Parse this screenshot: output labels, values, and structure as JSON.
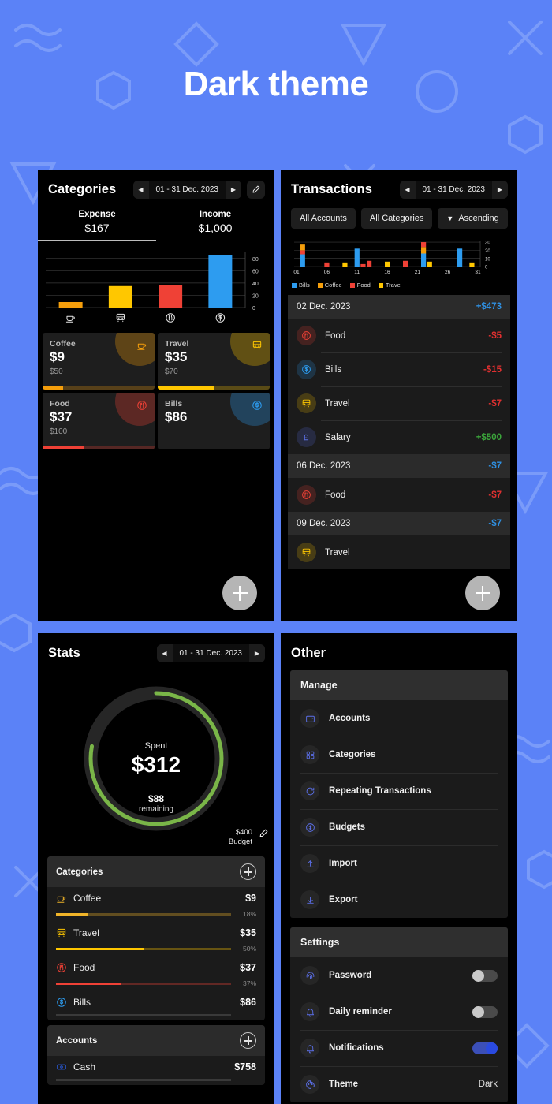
{
  "hero": {
    "title": "Dark theme"
  },
  "colors": {
    "background": "#5b82f7",
    "panel": "#000000",
    "coffee": "#f59e0b",
    "travel": "#ffc700",
    "food": "#ef4136",
    "bills": "#2d9cf0",
    "income_green": "#3ba53b",
    "expense_red": "#e03030",
    "accent_blue": "#2f8fe0",
    "donut_green": "#7ab648"
  },
  "categories_panel": {
    "title": "Categories",
    "date_range": "01 - 31 Dec. 2023",
    "prev_icon": "chevron-left-icon",
    "next_icon": "chevron-right-icon",
    "edit_icon": "pencil-icon",
    "summary": [
      {
        "label": "Expense",
        "value": "$167",
        "selected": true
      },
      {
        "label": "Income",
        "value": "$1,000",
        "selected": false
      }
    ],
    "chart_data": {
      "type": "bar",
      "title": "Expense by category",
      "categories": [
        "Coffee",
        "Travel",
        "Food",
        "Bills"
      ],
      "values": [
        9,
        35,
        37,
        86
      ],
      "colors": [
        "#f59e0b",
        "#ffc700",
        "#ef4136",
        "#2d9cf0"
      ],
      "icons": [
        "coffee-icon",
        "bus-icon",
        "food-icon",
        "dollar-coin-icon"
      ],
      "ylim": [
        0,
        90
      ],
      "yticks": [
        0,
        20,
        40,
        60,
        80
      ],
      "xlabel": "",
      "ylabel": "",
      "grid": true,
      "legend": "none"
    },
    "cards": [
      {
        "name": "Coffee",
        "amount": "$9",
        "budget": "$50",
        "progress": 18,
        "color": "#f59e0b",
        "icon": "coffee-icon"
      },
      {
        "name": "Travel",
        "amount": "$35",
        "budget": "$70",
        "progress": 50,
        "color": "#ffc700",
        "icon": "bus-icon"
      },
      {
        "name": "Food",
        "amount": "$37",
        "budget": "$100",
        "progress": 37,
        "color": "#ef4136",
        "icon": "food-icon"
      },
      {
        "name": "Bills",
        "amount": "$86",
        "budget": "",
        "progress": 0,
        "color": "#2d9cf0",
        "icon": "dollar-coin-icon"
      }
    ],
    "fab_icon": "plus-icon"
  },
  "transactions_panel": {
    "title": "Transactions",
    "date_range": "01 - 31 Dec. 2023",
    "filters": [
      {
        "label": "All Accounts",
        "icon": ""
      },
      {
        "label": "All Categories",
        "icon": ""
      },
      {
        "label": "Ascending",
        "icon": "sort-triangle-icon"
      }
    ],
    "chart_data": {
      "type": "bar",
      "title": "Transactions by day",
      "x": [
        1,
        2,
        3,
        4,
        5,
        6,
        7,
        8,
        9,
        10,
        11,
        12,
        13,
        14,
        15,
        16,
        17,
        18,
        19,
        20,
        21,
        22,
        23,
        24,
        25,
        26,
        27,
        28,
        29,
        30,
        31
      ],
      "xticks": [
        "01",
        "06",
        "11",
        "16",
        "21",
        "26",
        "31"
      ],
      "yticks": [
        0,
        10,
        20,
        30
      ],
      "ylim": [
        0,
        32
      ],
      "legend": [
        "Bills",
        "Coffee",
        "Food",
        "Travel"
      ],
      "legend_colors": [
        "#2d9cf0",
        "#f59e0b",
        "#ef4136",
        "#ffc700"
      ],
      "legend_position": "bottom-left",
      "stacked_bars": [
        {
          "day": 2,
          "segments": [
            {
              "series": "Bills",
              "value": 15
            },
            {
              "series": "Food",
              "value": 5
            },
            {
              "series": "Coffee",
              "value": 7
            }
          ]
        },
        {
          "day": 6,
          "segments": [
            {
              "series": "Food",
              "value": 5
            }
          ]
        },
        {
          "day": 9,
          "segments": [
            {
              "series": "Travel",
              "value": 5
            }
          ]
        },
        {
          "day": 11,
          "segments": [
            {
              "series": "Bills",
              "value": 22
            }
          ]
        },
        {
          "day": 12,
          "segments": [
            {
              "series": "Food",
              "value": 3
            }
          ]
        },
        {
          "day": 13,
          "segments": [
            {
              "series": "Food",
              "value": 7
            }
          ]
        },
        {
          "day": 16,
          "segments": [
            {
              "series": "Travel",
              "value": 6
            }
          ]
        },
        {
          "day": 19,
          "segments": [
            {
              "series": "Food",
              "value": 7
            }
          ]
        },
        {
          "day": 22,
          "segments": [
            {
              "series": "Bills",
              "value": 16
            },
            {
              "series": "Coffee",
              "value": 8
            },
            {
              "series": "Food",
              "value": 6
            }
          ]
        },
        {
          "day": 23,
          "segments": [
            {
              "series": "Travel",
              "value": 6
            }
          ]
        },
        {
          "day": 28,
          "segments": [
            {
              "series": "Bills",
              "value": 22
            }
          ]
        },
        {
          "day": 30,
          "segments": [
            {
              "series": "Travel",
              "value": 5
            }
          ]
        }
      ]
    },
    "groups": [
      {
        "date": "02 Dec. 2023",
        "total": "+$473",
        "items": [
          {
            "name": "Food",
            "amount": "-$5",
            "type": "expense",
            "icon": "food-icon",
            "color": "#ef4136"
          },
          {
            "name": "Bills",
            "amount": "-$15",
            "type": "expense",
            "icon": "dollar-coin-icon",
            "color": "#2d9cf0"
          },
          {
            "name": "Travel",
            "amount": "-$7",
            "type": "expense",
            "icon": "bus-icon",
            "color": "#ffc700"
          },
          {
            "name": "Salary",
            "amount": "+$500",
            "type": "income",
            "icon": "pound-icon",
            "color": "#5b6fe0"
          }
        ]
      },
      {
        "date": "06 Dec. 2023",
        "total": "-$7",
        "items": [
          {
            "name": "Food",
            "amount": "-$7",
            "type": "expense",
            "icon": "food-icon",
            "color": "#ef4136"
          }
        ]
      },
      {
        "date": "09 Dec. 2023",
        "total": "-$7",
        "items": [
          {
            "name": "Travel",
            "amount": "",
            "type": "expense",
            "icon": "bus-icon",
            "color": "#ffc700"
          }
        ]
      }
    ],
    "fab_icon": "plus-icon"
  },
  "stats_panel": {
    "title": "Stats",
    "date_range": "01 - 31 Dec. 2023",
    "donut": {
      "spent_label": "Spent",
      "spent_amount": "$312",
      "remaining_amount": "$88",
      "remaining_label": "remaining",
      "budget_amount": "$400",
      "budget_label": "Budget",
      "percent": 78,
      "edit_icon": "pencil-icon"
    },
    "categories_card": {
      "title": "Categories",
      "add_icon": "plus-circle-icon",
      "rows": [
        {
          "name": "Coffee",
          "amount": "$9",
          "percent": "18%",
          "progress": 18,
          "color": "#f0b429",
          "icon": "coffee-icon"
        },
        {
          "name": "Travel",
          "amount": "$35",
          "percent": "50%",
          "progress": 50,
          "color": "#ffc700",
          "icon": "bus-icon"
        },
        {
          "name": "Food",
          "amount": "$37",
          "percent": "37%",
          "progress": 37,
          "color": "#ef4136",
          "icon": "food-icon"
        },
        {
          "name": "Bills",
          "amount": "$86",
          "percent": "",
          "progress": 0,
          "color": "#2d9cf0",
          "icon": "dollar-coin-icon"
        }
      ]
    },
    "accounts_card": {
      "title": "Accounts",
      "add_icon": "plus-circle-icon",
      "rows": [
        {
          "name": "Cash",
          "amount": "$758",
          "icon": "cash-icon",
          "color": "#2a5ce0"
        }
      ]
    }
  },
  "other_panel": {
    "title": "Other",
    "sections": [
      {
        "title": "Manage",
        "rows": [
          {
            "label": "Accounts",
            "icon": "wallet-icon"
          },
          {
            "label": "Categories",
            "icon": "grid-icon"
          },
          {
            "label": "Repeating Transactions",
            "icon": "refresh-icon"
          },
          {
            "label": "Budgets",
            "icon": "budget-icon"
          },
          {
            "label": "Import",
            "icon": "import-icon"
          },
          {
            "label": "Export",
            "icon": "export-icon"
          }
        ]
      },
      {
        "title": "Settings",
        "rows": [
          {
            "label": "Password",
            "icon": "fingerprint-icon",
            "control": "toggle",
            "state": "off"
          },
          {
            "label": "Daily reminder",
            "icon": "bell-icon",
            "control": "toggle",
            "state": "off"
          },
          {
            "label": "Notifications",
            "icon": "bell-ring-icon",
            "control": "toggle",
            "state": "on"
          },
          {
            "label": "Theme",
            "icon": "palette-icon",
            "control": "value",
            "value": "Dark"
          }
        ]
      }
    ]
  }
}
